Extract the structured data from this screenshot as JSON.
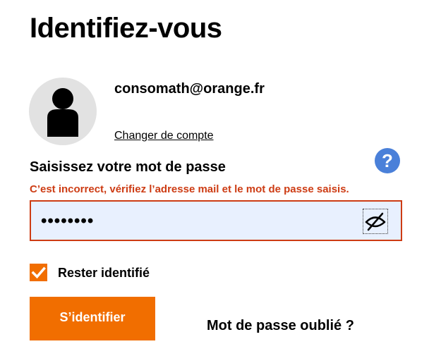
{
  "page": {
    "title": "Identifiez-vous"
  },
  "account": {
    "avatar_icon": "user-silhouette-icon",
    "email": "consomath@orange.fr",
    "change_account_label": "Changer de compte"
  },
  "password": {
    "label": "Saisissez votre mot de passe",
    "help_icon": "question-mark-icon",
    "help_label": "?",
    "error_message": "C’est incorrect, vérifiez l’adresse mail et le mot de passe saisis.",
    "masked_value": "••••••••",
    "visibility_icon": "eye-slash-icon"
  },
  "remember": {
    "checked": true,
    "label": "Rester identifié"
  },
  "actions": {
    "submit_label": "S’identifier",
    "forgot_label": "Mot de passe oublié ?"
  },
  "colors": {
    "brand_orange": "#f16e00",
    "error_red": "#cd3c14",
    "help_blue": "#4a80d9",
    "input_autofill_bg": "#e8f0fe",
    "avatar_bg": "#e2e2e2"
  }
}
